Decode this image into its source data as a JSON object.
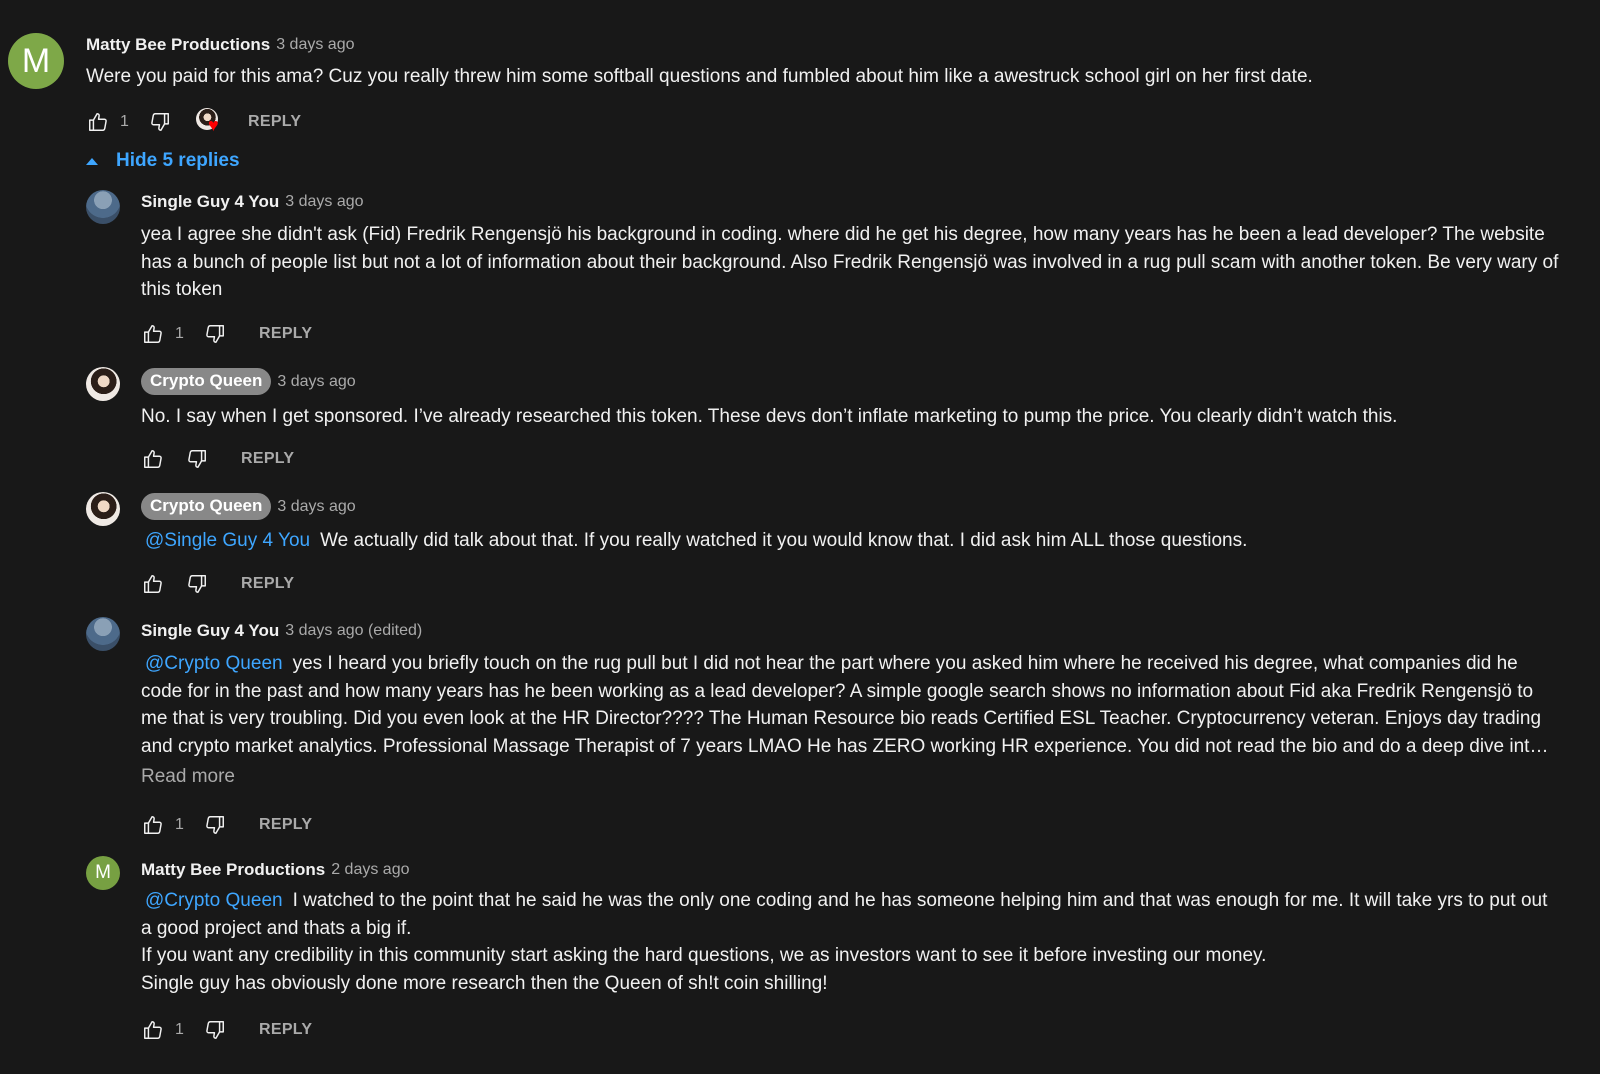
{
  "colors": {
    "background": "#181818",
    "text": "#f1f1f1",
    "secondary_text": "#aaaaaa",
    "link_blue": "#3ea6ff",
    "owner_pill": "#888888",
    "avatar_green": "#77a042",
    "heart_red": "#ff0000"
  },
  "top_comment": {
    "avatar_letter": "M",
    "author": "Matty Bee Productions",
    "time": "3 days ago",
    "text": "Were you paid for this ama? Cuz you really threw him some softball questions and fumbled about him like a awestruck school girl on her first date.",
    "like_count": "1",
    "hearted": true,
    "reply_label": "REPLY",
    "hide_replies_label": "Hide 5 replies"
  },
  "replies": [
    {
      "author": "Single Guy 4 You",
      "owner": false,
      "time": "3 days ago",
      "mention": "",
      "lines": [
        "yea I agree she didn't ask (Fid) Fredrik Rengensjö his background in coding. where did he get his degree, how many years has he been a lead developer? The website has a bunch of people list but not a lot of information about their background.  Also Fredrik Rengensjö was involved in a  rug pull scam with another token. Be very wary of this token"
      ],
      "like_count": "1",
      "reply_label": "REPLY"
    },
    {
      "author": "Crypto Queen",
      "owner": true,
      "time": "3 days ago",
      "mention": "",
      "lines": [
        "No. I say when I get sponsored. I’ve already researched this token. These devs don’t inflate marketing to pump the price. You clearly didn’t watch this."
      ],
      "like_count": "",
      "reply_label": "REPLY"
    },
    {
      "author": "Crypto Queen",
      "owner": true,
      "time": "3 days ago",
      "mention": "@Single Guy 4 You",
      "lines": [
        "We actually did talk about that. If you really watched it you would know that. I did ask him ALL those questions."
      ],
      "like_count": "",
      "reply_label": "REPLY"
    },
    {
      "author": "Single Guy 4 You",
      "owner": false,
      "time": "3 days ago (edited)",
      "mention": "@Crypto Queen",
      "lines": [
        "yes I heard you briefly touch on the rug pull but I did not hear the part where you asked him where he received his degree, what companies did he code for in the past and how many years has he been working as a lead developer? A simple google search shows no information about Fid aka Fredrik Rengensjö to me that is very troubling. Did you even look at the HR Director???? The Human Resource bio reads Certified ESL Teacher. Cryptocurrency veteran. Enjoys day trading and crypto market analytics. Professional Massage Therapist of 7 years LMAO He has ZERO working HR experience. You did not read the bio and do a deep dive int…"
      ],
      "read_more": "Read more",
      "like_count": "1",
      "reply_label": "REPLY"
    },
    {
      "author": "Matty Bee Productions",
      "owner": false,
      "avatar_letter": "M",
      "time": "2 days ago",
      "mention": "@Crypto Queen",
      "lines": [
        "I watched to the point that he said he was the only one coding and he has someone helping him and that was enough for me. It will take yrs to put out a good project and thats a big if.",
        "If you want any credibility in this community start asking the hard questions, we as investors want to see it before investing our money.",
        "Single guy has obviously done more research then the Queen of sh!t coin shilling!"
      ],
      "like_count": "1",
      "reply_label": "REPLY"
    }
  ]
}
